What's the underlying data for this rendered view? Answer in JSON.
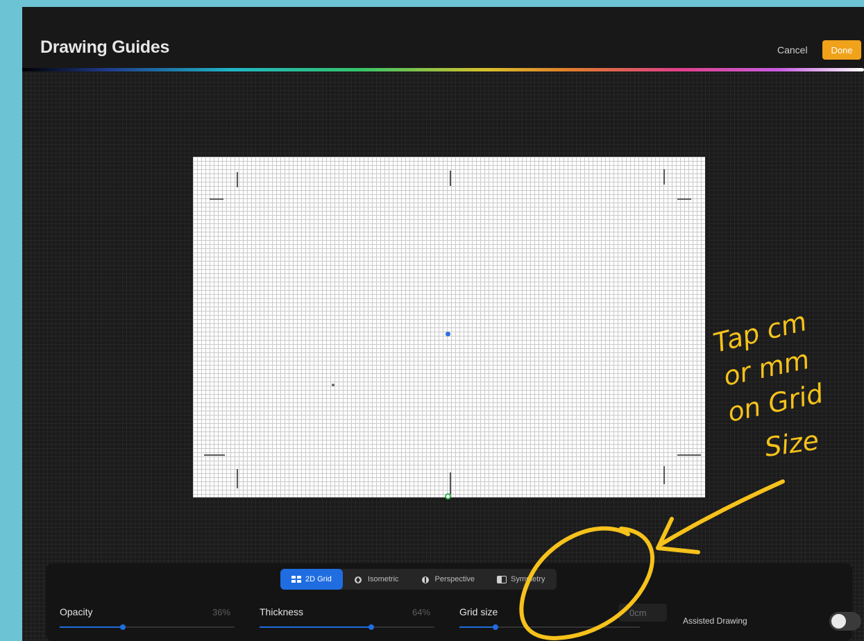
{
  "header": {
    "title": "Drawing Guides",
    "cancel_label": "Cancel",
    "done_label": "Done"
  },
  "tabs": [
    {
      "label": "2D Grid",
      "active": true,
      "icon": "grid-icon"
    },
    {
      "label": "Isometric",
      "active": false,
      "icon": "isometric-icon"
    },
    {
      "label": "Perspective",
      "active": false,
      "icon": "perspective-icon"
    },
    {
      "label": "Symmetry",
      "active": false,
      "icon": "symmetry-icon"
    }
  ],
  "controls": {
    "opacity": {
      "label": "Opacity",
      "value": "36%",
      "level": 0.36
    },
    "thickness": {
      "label": "Thickness",
      "value": "64%",
      "level": 0.64
    },
    "grid_size": {
      "label": "Grid size",
      "value": "0cm",
      "level": 0.2
    },
    "assisted_drawing": {
      "label": "Assisted Drawing",
      "on": false
    }
  },
  "annotation": {
    "lines": [
      "Tap cm",
      "or mm",
      "on Grid",
      "Size"
    ],
    "color": "#f6c21b"
  },
  "colors": {
    "accent": "#1f6de0",
    "done": "#f0a21b"
  }
}
